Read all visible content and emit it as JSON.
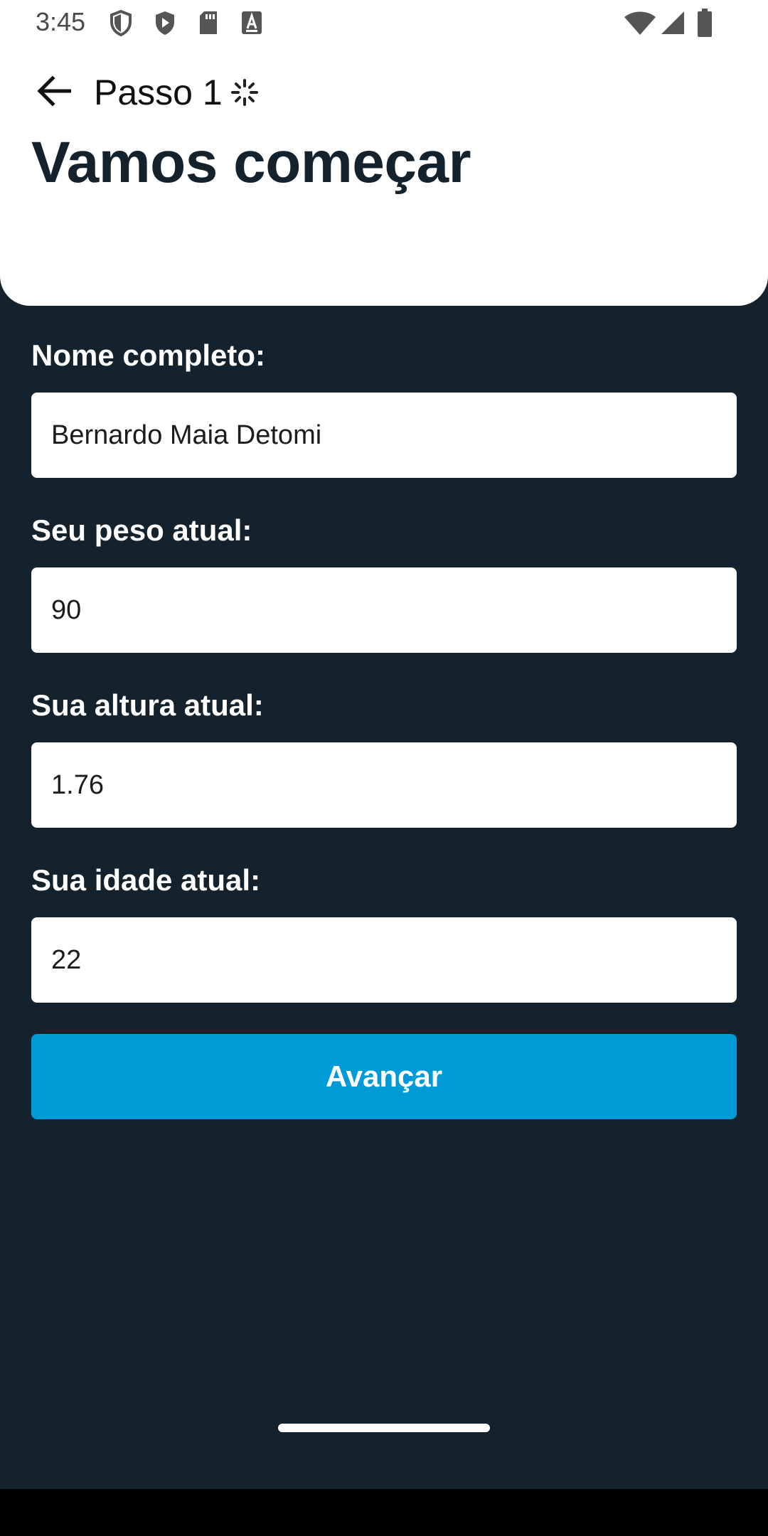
{
  "status_bar": {
    "time": "3:45",
    "icons": [
      "shield-outline-icon",
      "shield-play-icon",
      "sd-card-icon",
      "font-a-icon",
      "wifi-icon",
      "signal-icon",
      "battery-icon"
    ]
  },
  "header": {
    "back_icon": "arrow-left-icon",
    "step": "Passo 1",
    "loading_icon": "spinner-icon",
    "title": "Vamos começar"
  },
  "form": {
    "name_label": "Nome completo:",
    "name_value": "Bernardo Maia Detomi",
    "weight_label": "Seu peso atual:",
    "weight_value": "90",
    "height_label": "Sua altura atual:",
    "height_value": "1.76",
    "age_label": "Sua idade atual:",
    "age_value": "22"
  },
  "actions": {
    "next_label": "Avançar"
  },
  "colors": {
    "background": "#13222c",
    "header": "#ffffff",
    "accent": "#009bd6",
    "title": "#13222c"
  }
}
